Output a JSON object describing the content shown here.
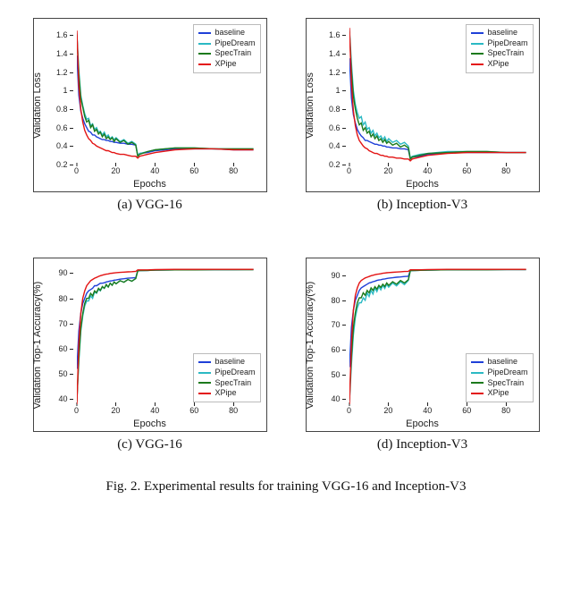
{
  "figure_caption": "Fig. 2.   Experimental results for training VGG-16  and Inception-V3",
  "legend_labels": [
    "baseline",
    "PipeDream",
    "SpecTrain",
    "XPipe"
  ],
  "legend_colors": [
    "#1f40d8",
    "#2bb9c4",
    "#1c7a1c",
    "#e31414"
  ],
  "panels": [
    {
      "id": "a",
      "caption": "(a)  VGG-16",
      "xlabel": "Epochs",
      "ylabel": "Validation Loss",
      "legend_pos": "top-right"
    },
    {
      "id": "b",
      "caption": "(b)  Inception-V3",
      "xlabel": "Epochs",
      "ylabel": "Validation Loss",
      "legend_pos": "top-right"
    },
    {
      "id": "c",
      "caption": "(c)  VGG-16",
      "xlabel": "Epochs",
      "ylabel": "Validation Top-1 Accuracy(%)",
      "legend_pos": "bottom-right"
    },
    {
      "id": "d",
      "caption": "(d)  Inception-V3",
      "xlabel": "Epochs",
      "ylabel": "Validation Top-1 Accuracy(%)",
      "legend_pos": "bottom-right"
    }
  ],
  "chart_data": [
    {
      "type": "line",
      "title": "(a) VGG-16",
      "xlabel": "Epochs",
      "ylabel": "Validation Loss",
      "xlim": [
        0,
        92
      ],
      "ylim": [
        0.2,
        1.7
      ],
      "xticks": [
        0,
        20,
        40,
        60,
        80
      ],
      "yticks": [
        0.2,
        0.4,
        0.6,
        0.8,
        1.0,
        1.2,
        1.4,
        1.6
      ],
      "x": [
        0,
        1,
        2,
        3,
        4,
        5,
        6,
        7,
        8,
        9,
        10,
        11,
        12,
        13,
        14,
        15,
        16,
        17,
        18,
        19,
        20,
        22,
        24,
        26,
        28,
        30,
        31,
        32,
        36,
        40,
        50,
        60,
        70,
        80,
        90
      ],
      "series": [
        {
          "name": "baseline",
          "color": "#1f40d8",
          "values": [
            1.38,
            0.95,
            0.78,
            0.7,
            0.64,
            0.6,
            0.56,
            0.55,
            0.52,
            0.52,
            0.5,
            0.49,
            0.48,
            0.47,
            0.47,
            0.46,
            0.46,
            0.45,
            0.45,
            0.44,
            0.44,
            0.43,
            0.43,
            0.42,
            0.42,
            0.41,
            0.3,
            0.32,
            0.33,
            0.35,
            0.37,
            0.37,
            0.37,
            0.36,
            0.36
          ]
        },
        {
          "name": "PipeDream",
          "color": "#2bb9c4",
          "values": [
            1.62,
            1.22,
            0.95,
            0.84,
            0.75,
            0.69,
            0.7,
            0.62,
            0.64,
            0.58,
            0.6,
            0.55,
            0.56,
            0.52,
            0.55,
            0.5,
            0.52,
            0.48,
            0.5,
            0.47,
            0.49,
            0.45,
            0.47,
            0.43,
            0.45,
            0.42,
            0.3,
            0.32,
            0.34,
            0.36,
            0.38,
            0.38,
            0.37,
            0.37,
            0.37
          ]
        },
        {
          "name": "SpecTrain",
          "color": "#1c7a1c",
          "values": [
            1.6,
            1.18,
            0.92,
            0.82,
            0.72,
            0.66,
            0.68,
            0.6,
            0.63,
            0.56,
            0.58,
            0.53,
            0.55,
            0.5,
            0.53,
            0.48,
            0.5,
            0.47,
            0.49,
            0.45,
            0.48,
            0.44,
            0.46,
            0.42,
            0.44,
            0.41,
            0.29,
            0.31,
            0.34,
            0.36,
            0.38,
            0.38,
            0.37,
            0.37,
            0.37
          ]
        },
        {
          "name": "XPipe",
          "color": "#e31414",
          "values": [
            1.65,
            1.05,
            0.8,
            0.66,
            0.57,
            0.52,
            0.48,
            0.46,
            0.43,
            0.42,
            0.4,
            0.39,
            0.38,
            0.37,
            0.36,
            0.35,
            0.35,
            0.34,
            0.33,
            0.33,
            0.32,
            0.31,
            0.31,
            0.3,
            0.29,
            0.29,
            0.27,
            0.29,
            0.31,
            0.33,
            0.36,
            0.37,
            0.37,
            0.36,
            0.36
          ]
        }
      ]
    },
    {
      "type": "line",
      "title": "(b) Inception-V3",
      "xlabel": "Epochs",
      "ylabel": "Validation Loss",
      "xlim": [
        0,
        92
      ],
      "ylim": [
        0.2,
        1.7
      ],
      "xticks": [
        0,
        20,
        40,
        60,
        80
      ],
      "yticks": [
        0.2,
        0.4,
        0.6,
        0.8,
        1.0,
        1.2,
        1.4,
        1.6
      ],
      "x": [
        0,
        1,
        2,
        3,
        4,
        5,
        6,
        7,
        8,
        9,
        10,
        11,
        12,
        13,
        14,
        15,
        16,
        17,
        18,
        19,
        20,
        22,
        24,
        26,
        28,
        30,
        31,
        32,
        36,
        40,
        50,
        60,
        70,
        80,
        90
      ],
      "series": [
        {
          "name": "baseline",
          "color": "#1f40d8",
          "values": [
            1.35,
            0.92,
            0.74,
            0.65,
            0.58,
            0.54,
            0.51,
            0.49,
            0.46,
            0.46,
            0.45,
            0.44,
            0.43,
            0.42,
            0.42,
            0.41,
            0.41,
            0.4,
            0.4,
            0.39,
            0.39,
            0.38,
            0.38,
            0.37,
            0.37,
            0.36,
            0.26,
            0.28,
            0.29,
            0.31,
            0.33,
            0.33,
            0.33,
            0.33,
            0.33
          ]
        },
        {
          "name": "PipeDream",
          "color": "#2bb9c4",
          "values": [
            1.66,
            1.3,
            1.0,
            0.85,
            0.76,
            0.7,
            0.72,
            0.63,
            0.66,
            0.58,
            0.6,
            0.54,
            0.57,
            0.51,
            0.54,
            0.49,
            0.51,
            0.47,
            0.5,
            0.45,
            0.48,
            0.44,
            0.46,
            0.42,
            0.44,
            0.4,
            0.27,
            0.29,
            0.31,
            0.32,
            0.34,
            0.34,
            0.34,
            0.33,
            0.33
          ]
        },
        {
          "name": "SpecTrain",
          "color": "#1c7a1c",
          "values": [
            1.64,
            1.22,
            0.94,
            0.8,
            0.7,
            0.63,
            0.65,
            0.57,
            0.6,
            0.54,
            0.56,
            0.5,
            0.53,
            0.48,
            0.51,
            0.46,
            0.48,
            0.44,
            0.47,
            0.43,
            0.45,
            0.41,
            0.43,
            0.39,
            0.41,
            0.38,
            0.26,
            0.28,
            0.3,
            0.32,
            0.33,
            0.34,
            0.34,
            0.33,
            0.33
          ]
        },
        {
          "name": "XPipe",
          "color": "#e31414",
          "values": [
            1.68,
            1.08,
            0.78,
            0.62,
            0.52,
            0.46,
            0.43,
            0.4,
            0.38,
            0.37,
            0.35,
            0.34,
            0.33,
            0.32,
            0.32,
            0.31,
            0.3,
            0.3,
            0.29,
            0.29,
            0.28,
            0.28,
            0.27,
            0.27,
            0.26,
            0.26,
            0.24,
            0.26,
            0.28,
            0.3,
            0.32,
            0.33,
            0.33,
            0.33,
            0.33
          ]
        }
      ]
    },
    {
      "type": "line",
      "title": "(c) VGG-16",
      "xlabel": "Epochs",
      "ylabel": "Validation Top-1 Accuracy(%)",
      "xlim": [
        0,
        92
      ],
      "ylim": [
        38,
        93
      ],
      "xticks": [
        0,
        20,
        40,
        60,
        80
      ],
      "yticks": [
        40,
        50,
        60,
        70,
        80,
        90
      ],
      "x": [
        0,
        1,
        2,
        3,
        4,
        5,
        6,
        7,
        8,
        9,
        10,
        11,
        12,
        13,
        14,
        15,
        16,
        17,
        18,
        19,
        20,
        22,
        24,
        26,
        28,
        30,
        31,
        32,
        36,
        40,
        50,
        60,
        70,
        80,
        90
      ],
      "series": [
        {
          "name": "baseline",
          "color": "#1f40d8",
          "values": [
            52,
            67,
            74,
            78,
            80,
            82,
            83,
            83.5,
            84,
            85,
            85,
            85.5,
            86,
            86,
            86.2,
            86.5,
            86.7,
            86.9,
            87,
            87.2,
            87.3,
            87.6,
            87.8,
            88,
            88.1,
            88.2,
            91,
            91,
            91.1,
            91.2,
            91.3,
            91.4,
            91.4,
            91.4,
            91.5
          ]
        },
        {
          "name": "PipeDream",
          "color": "#2bb9c4",
          "values": [
            40,
            55,
            67,
            73,
            77,
            79,
            79,
            81,
            80,
            82.5,
            82,
            83.5,
            83,
            84.5,
            84,
            85.2,
            84.5,
            86,
            85.2,
            86.5,
            85.8,
            87,
            86.4,
            87.5,
            86.8,
            87.9,
            90.9,
            91,
            91.1,
            91.2,
            91.3,
            91.3,
            91.4,
            91.4,
            91.4
          ]
        },
        {
          "name": "SpecTrain",
          "color": "#1c7a1c",
          "values": [
            39,
            56,
            68,
            74,
            78,
            80,
            80,
            82,
            81,
            83,
            82.3,
            84,
            83.2,
            84.7,
            84,
            85.5,
            84.5,
            86,
            85.2,
            86.5,
            85.8,
            87,
            86.4,
            87.5,
            86.8,
            87.9,
            90.9,
            91,
            91.1,
            91.2,
            91.3,
            91.3,
            91.4,
            91.4,
            91.4
          ]
        },
        {
          "name": "XPipe",
          "color": "#e31414",
          "values": [
            38,
            62,
            74,
            80,
            83,
            85,
            86,
            87,
            87.5,
            88,
            88.3,
            88.7,
            89,
            89.2,
            89.4,
            89.6,
            89.7,
            89.9,
            90,
            90.1,
            90.2,
            90.3,
            90.4,
            90.5,
            90.6,
            90.7,
            91.3,
            91.3,
            91.3,
            91.4,
            91.5,
            91.5,
            91.5,
            91.5,
            91.5
          ]
        }
      ]
    },
    {
      "type": "line",
      "title": "(d) Inception-V3",
      "xlabel": "Epochs",
      "ylabel": "Validation Top-1 Accuracy(%)",
      "xlim": [
        0,
        92
      ],
      "ylim": [
        38,
        94
      ],
      "xticks": [
        0,
        20,
        40,
        60,
        80
      ],
      "yticks": [
        40,
        50,
        60,
        70,
        80,
        90
      ],
      "x": [
        0,
        1,
        2,
        3,
        4,
        5,
        6,
        7,
        8,
        9,
        10,
        11,
        12,
        13,
        14,
        15,
        16,
        17,
        18,
        19,
        20,
        22,
        24,
        26,
        28,
        30,
        31,
        32,
        36,
        40,
        50,
        60,
        70,
        80,
        90
      ],
      "series": [
        {
          "name": "baseline",
          "color": "#1f40d8",
          "values": [
            53,
            69,
            76,
            80,
            82,
            84,
            85,
            85.5,
            86,
            86.5,
            87,
            87.2,
            87.5,
            87.7,
            88,
            88.2,
            88.3,
            88.5,
            88.6,
            88.8,
            88.9,
            89.1,
            89.3,
            89.4,
            89.6,
            89.7,
            92,
            92,
            92.1,
            92.2,
            92.3,
            92.3,
            92.4,
            92.4,
            92.4
          ]
        },
        {
          "name": "PipeDream",
          "color": "#2bb9c4",
          "values": [
            39,
            54,
            66,
            73,
            77,
            79,
            79,
            81,
            80,
            83,
            81.5,
            84,
            82.5,
            85,
            83.5,
            85.5,
            84.2,
            86,
            84.8,
            86.5,
            85.3,
            87,
            85.8,
            87.5,
            86.3,
            88,
            91.9,
            92,
            92.1,
            92.2,
            92.3,
            92.3,
            92.3,
            92.4,
            92.4
          ]
        },
        {
          "name": "SpecTrain",
          "color": "#1c7a1c",
          "values": [
            40,
            57,
            69,
            75,
            79,
            81,
            81,
            83,
            82,
            84,
            83,
            85,
            84,
            85.5,
            84.5,
            86,
            85.2,
            86.5,
            85.6,
            87,
            86,
            87.5,
            86.5,
            88,
            87,
            88.3,
            92,
            92,
            92.1,
            92.2,
            92.3,
            92.3,
            92.3,
            92.4,
            92.4
          ]
        },
        {
          "name": "XPipe",
          "color": "#e31414",
          "values": [
            38,
            63,
            76,
            82,
            85,
            87,
            88,
            88.5,
            89,
            89.3,
            89.6,
            89.9,
            90.1,
            90.3,
            90.5,
            90.6,
            90.7,
            90.9,
            91,
            91.1,
            91.2,
            91.3,
            91.4,
            91.5,
            91.6,
            91.7,
            92.3,
            92.3,
            92.3,
            92.4,
            92.5,
            92.5,
            92.5,
            92.5,
            92.5
          ]
        }
      ]
    }
  ]
}
